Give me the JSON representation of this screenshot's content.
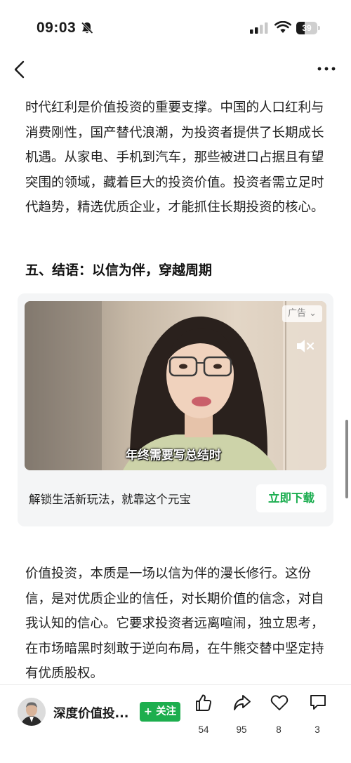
{
  "status_bar": {
    "time": "09:03",
    "battery_percent": 39,
    "battery_label": "39",
    "icons": [
      "bell-slash-icon",
      "signal-icon",
      "wifi-icon",
      "battery-icon"
    ]
  },
  "nav": {
    "back_icon": "chevron-left-icon",
    "more_icon": "more-dots-icon"
  },
  "article": {
    "paragraph_1": "时代红利是价值投资的重要支撑。中国的人口红利与消费刚性，国产替代浪潮，为投资者提供了长期成长机遇。从家电、手机到汽车，那些被进口占据且有望突围的领域，藏着巨大的投资价值。投资者需立足时代趋势，精选优质企业，才能抓住长期投资的核心。",
    "section_heading": "五、结语：以信为伴，穿越周期",
    "paragraph_2": "价值投资，本质是一场以信为伴的漫长修行。这份信，是对优质企业的信任，对长期价值的信念，对自我认知的信心。它要求投资者远离喧闹，独立思考，在市场暗黑时刻敢于逆向布局，在牛熊交替中坚定持有优质股权。"
  },
  "ad": {
    "badge": "广告",
    "video_caption": "年终需要写总结时",
    "description": "解锁生活新玩法，就靠这个元宝",
    "cta": "立即下载",
    "mute_icon": "speaker-muted-icon"
  },
  "bottom_bar": {
    "author_name": "深度价值投...",
    "follow_label": "+ 关注",
    "like_count": "54",
    "share_count": "95",
    "favorite_count": "8",
    "comment_count": "3",
    "accent_color": "#1dae4e"
  }
}
